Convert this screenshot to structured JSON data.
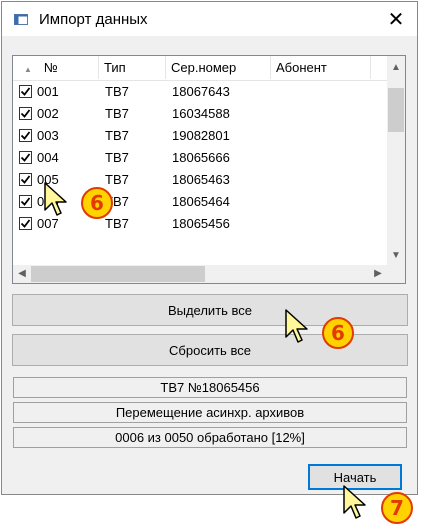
{
  "window": {
    "title": "Импорт данных",
    "close_glyph": "✕"
  },
  "list": {
    "columns": [
      "№",
      "Тип",
      "Сер.номер",
      "Абонент"
    ],
    "sort_indicator": "▲",
    "rows": [
      {
        "num": "001",
        "type": "ТВ7",
        "serial": "18067643",
        "checked": true
      },
      {
        "num": "002",
        "type": "ТВ7",
        "serial": "16034588",
        "checked": true
      },
      {
        "num": "003",
        "type": "ТВ7",
        "serial": "19082801",
        "checked": true
      },
      {
        "num": "004",
        "type": "ТВ7",
        "serial": "18065666",
        "checked": true
      },
      {
        "num": "005",
        "type": "ТВ7",
        "serial": "18065463",
        "checked": true
      },
      {
        "num": "006",
        "type": "ТВ7",
        "serial": "18065464",
        "checked": true
      },
      {
        "num": "007",
        "type": "ТВ7",
        "serial": "18065456",
        "checked": true
      }
    ]
  },
  "buttons": {
    "select_all": "Выделить все",
    "reset_all": "Сбросить все",
    "start": "Начать"
  },
  "status": {
    "device": "ТВ7 №18065456",
    "operation": "Перемещение асинхр. архивов",
    "progress": "0006 из 0050 обработано [12%]"
  },
  "markers": [
    "6",
    "6",
    "7"
  ],
  "icons": {
    "app": "app-window-icon",
    "close": "close-icon",
    "checkbox": "checkmark-icon",
    "cursor": "mouse-pointer-icon"
  },
  "colors": {
    "marker_fill": "#ffd200",
    "marker_text": "#e23a00",
    "cursor_fill": "#fff799",
    "default_button_border": "#0078d7"
  }
}
